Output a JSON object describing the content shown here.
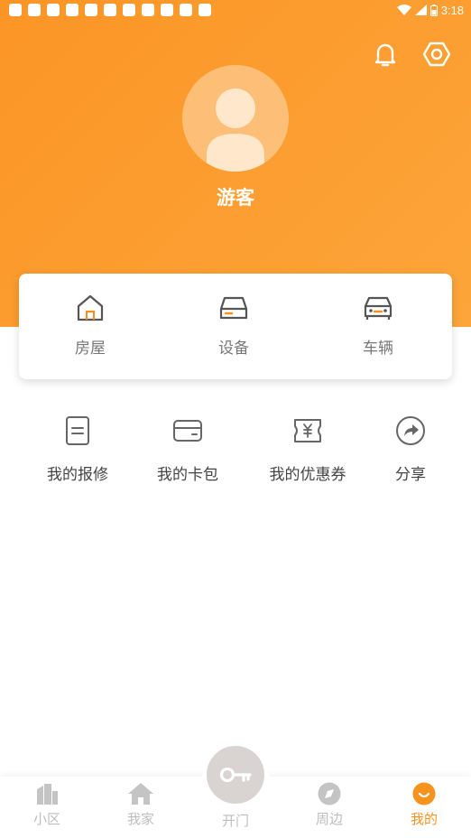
{
  "status_bar": {
    "time": "3:18"
  },
  "profile": {
    "name": "游客"
  },
  "quick_card": [
    {
      "label": "房屋",
      "icon": "house-icon"
    },
    {
      "label": "设备",
      "icon": "device-icon"
    },
    {
      "label": "车辆",
      "icon": "car-icon"
    }
  ],
  "services": [
    {
      "label": "我的报修",
      "icon": "repair-doc-icon"
    },
    {
      "label": "我的卡包",
      "icon": "wallet-card-icon"
    },
    {
      "label": "我的优惠券",
      "icon": "coupon-icon"
    },
    {
      "label": "分享",
      "icon": "share-icon"
    }
  ],
  "tabbar": {
    "items": [
      {
        "label": "小区",
        "icon": "building-icon"
      },
      {
        "label": "我家",
        "icon": "home-icon"
      },
      {
        "label": "开门",
        "icon": "key-icon"
      },
      {
        "label": "周边",
        "icon": "compass-icon"
      },
      {
        "label": "我的",
        "icon": "smile-icon"
      }
    ],
    "active": "我的"
  },
  "colors": {
    "brand_orange": "#fb9526",
    "active_tab": "#f6931f",
    "inactive_tab": "#bdbdbd"
  }
}
